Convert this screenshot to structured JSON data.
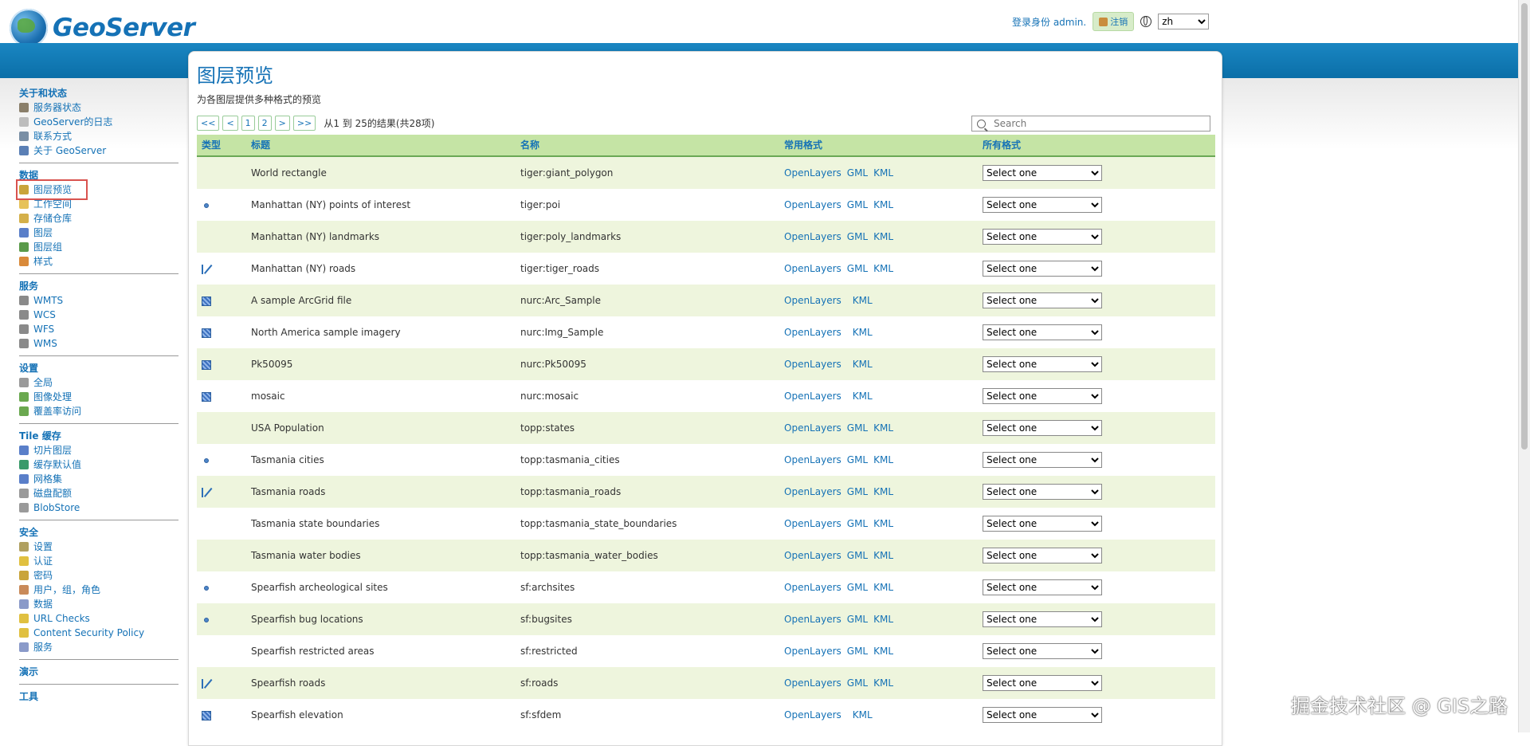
{
  "header": {
    "brand": "GeoServer",
    "user_label": "登录身份 admin.",
    "logout_label": "注销",
    "lang_value": "zh"
  },
  "sidebar": {
    "sections": [
      {
        "heading": "关于和状态",
        "items": [
          {
            "label": "服务器状态",
            "icon": "server-status-icon",
            "color": "#8a7f6a"
          },
          {
            "label": "GeoServer的日志",
            "icon": "log-file-icon",
            "color": "#bdbdbd"
          },
          {
            "label": "联系方式",
            "icon": "contact-card-icon",
            "color": "#7a8fa5"
          },
          {
            "label": "关于 GeoServer",
            "icon": "info-icon",
            "color": "#5a7fb5"
          }
        ]
      },
      {
        "heading": "数据",
        "items": [
          {
            "label": "图层预览",
            "icon": "layer-preview-icon",
            "color": "#c9a43a"
          },
          {
            "label": "工作空间",
            "icon": "folder-icon",
            "color": "#e6c25a"
          },
          {
            "label": "存储仓库",
            "icon": "store-icon",
            "color": "#d4b04a"
          },
          {
            "label": "图层",
            "icon": "layer-icon",
            "color": "#5a7fc9"
          },
          {
            "label": "图层组",
            "icon": "layer-group-icon",
            "color": "#5a9a4a"
          },
          {
            "label": "样式",
            "icon": "palette-icon",
            "color": "#d98a3a"
          }
        ]
      },
      {
        "heading": "服务",
        "items": [
          {
            "label": "WMTS",
            "icon": "wmts-service-icon",
            "color": "#8a8a8a"
          },
          {
            "label": "WCS",
            "icon": "wcs-service-icon",
            "color": "#8a8a8a"
          },
          {
            "label": "WFS",
            "icon": "wfs-service-icon",
            "color": "#8a8a8a"
          },
          {
            "label": "WMS",
            "icon": "wms-service-icon",
            "color": "#8a8a8a"
          }
        ]
      },
      {
        "heading": "设置",
        "items": [
          {
            "label": "全局",
            "icon": "global-settings-icon",
            "color": "#9a9a9a"
          },
          {
            "label": "图像处理",
            "icon": "image-processing-icon",
            "color": "#6aa84f"
          },
          {
            "label": "覆盖率访问",
            "icon": "coverage-access-icon",
            "color": "#6aa84f"
          }
        ]
      },
      {
        "heading": "Tile 缓存",
        "items": [
          {
            "label": "切片图层",
            "icon": "tile-layers-icon",
            "color": "#5a7fc9"
          },
          {
            "label": "缓存默认值",
            "icon": "cache-defaults-icon",
            "color": "#3a9a6a"
          },
          {
            "label": "网格集",
            "icon": "gridset-icon",
            "color": "#5a7fc9"
          },
          {
            "label": "磁盘配额",
            "icon": "disk-quota-icon",
            "color": "#9a9a9a"
          },
          {
            "label": "BlobStore",
            "icon": "blobstore-icon",
            "color": "#9a9a9a"
          }
        ]
      },
      {
        "heading": "安全",
        "items": [
          {
            "label": "设置",
            "icon": "key-icon",
            "color": "#b0a060"
          },
          {
            "label": "认证",
            "icon": "shield-icon",
            "color": "#e0c040"
          },
          {
            "label": "密码",
            "icon": "lock-icon",
            "color": "#c9a43a"
          },
          {
            "label": "用户，组，角色",
            "icon": "users-icon",
            "color": "#c98a5a"
          },
          {
            "label": "数据",
            "icon": "data-security-icon",
            "color": "#8a9ac9"
          },
          {
            "label": "URL Checks",
            "icon": "url-check-shield-icon",
            "color": "#e0c040"
          },
          {
            "label": "Content Security Policy",
            "icon": "csp-shield-icon",
            "color": "#e0c040"
          },
          {
            "label": "服务",
            "icon": "service-security-icon",
            "color": "#8a9ac9"
          }
        ]
      },
      {
        "heading": "演示",
        "items": []
      },
      {
        "heading": "工具",
        "items": []
      }
    ]
  },
  "main": {
    "title": "图层预览",
    "description": "为各图层提供多种格式的预览",
    "pager": {
      "first": "<<",
      "prev": "<",
      "page1": "1",
      "page2": "2",
      "next": ">",
      "last": ">>",
      "summary": "从1 到 25的结果(共28项)"
    },
    "search_placeholder": "Search",
    "columns": {
      "type": "类型",
      "title": "标题",
      "name": "名称",
      "common": "常用格式",
      "all": "所有格式"
    },
    "select_label": "Select one",
    "rows": [
      {
        "type": "polygon",
        "title": "World rectangle",
        "name": "tiger:giant_polygon",
        "formats": [
          "OpenLayers",
          "GML",
          "KML"
        ]
      },
      {
        "type": "point",
        "title": "Manhattan (NY) points of interest",
        "name": "tiger:poi",
        "formats": [
          "OpenLayers",
          "GML",
          "KML"
        ]
      },
      {
        "type": "polygon",
        "title": "Manhattan (NY) landmarks",
        "name": "tiger:poly_landmarks",
        "formats": [
          "OpenLayers",
          "GML",
          "KML"
        ]
      },
      {
        "type": "line",
        "title": "Manhattan (NY) roads",
        "name": "tiger:tiger_roads",
        "formats": [
          "OpenLayers",
          "GML",
          "KML"
        ]
      },
      {
        "type": "raster",
        "title": "A sample ArcGrid file",
        "name": "nurc:Arc_Sample",
        "formats": [
          "OpenLayers",
          "KML"
        ]
      },
      {
        "type": "raster",
        "title": "North America sample imagery",
        "name": "nurc:Img_Sample",
        "formats": [
          "OpenLayers",
          "KML"
        ]
      },
      {
        "type": "raster",
        "title": "Pk50095",
        "name": "nurc:Pk50095",
        "formats": [
          "OpenLayers",
          "KML"
        ]
      },
      {
        "type": "raster",
        "title": "mosaic",
        "name": "nurc:mosaic",
        "formats": [
          "OpenLayers",
          "KML"
        ]
      },
      {
        "type": "polygon",
        "title": "USA Population",
        "name": "topp:states",
        "formats": [
          "OpenLayers",
          "GML",
          "KML"
        ]
      },
      {
        "type": "point",
        "title": "Tasmania cities",
        "name": "topp:tasmania_cities",
        "formats": [
          "OpenLayers",
          "GML",
          "KML"
        ]
      },
      {
        "type": "line",
        "title": "Tasmania roads",
        "name": "topp:tasmania_roads",
        "formats": [
          "OpenLayers",
          "GML",
          "KML"
        ]
      },
      {
        "type": "polygon",
        "title": "Tasmania state boundaries",
        "name": "topp:tasmania_state_boundaries",
        "formats": [
          "OpenLayers",
          "GML",
          "KML"
        ]
      },
      {
        "type": "polygon",
        "title": "Tasmania water bodies",
        "name": "topp:tasmania_water_bodies",
        "formats": [
          "OpenLayers",
          "GML",
          "KML"
        ]
      },
      {
        "type": "point",
        "title": "Spearfish archeological sites",
        "name": "sf:archsites",
        "formats": [
          "OpenLayers",
          "GML",
          "KML"
        ]
      },
      {
        "type": "point",
        "title": "Spearfish bug locations",
        "name": "sf:bugsites",
        "formats": [
          "OpenLayers",
          "GML",
          "KML"
        ]
      },
      {
        "type": "polygon",
        "title": "Spearfish restricted areas",
        "name": "sf:restricted",
        "formats": [
          "OpenLayers",
          "GML",
          "KML"
        ]
      },
      {
        "type": "line",
        "title": "Spearfish roads",
        "name": "sf:roads",
        "formats": [
          "OpenLayers",
          "GML",
          "KML"
        ]
      },
      {
        "type": "raster",
        "title": "Spearfish elevation",
        "name": "sf:sfdem",
        "formats": [
          "OpenLayers",
          "KML"
        ]
      }
    ]
  },
  "watermark": "掘金技术社区 @ GIS之路",
  "colors": {
    "accent": "#1572b6",
    "header_bar": "#0b6fa8",
    "row_alt": "#eef5dd",
    "table_header": "#c5e4a5",
    "active_outline": "#d9534f"
  }
}
